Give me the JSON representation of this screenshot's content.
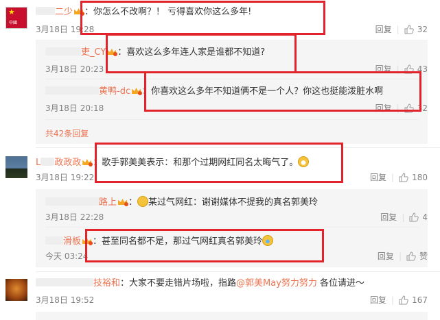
{
  "comments": [
    {
      "username_visible": "二少",
      "text": "：你怎么不改啊？！ 亏得喜欢你这么多年!",
      "time": "3月18日 19:28",
      "reply_label": "回复",
      "likes": "32",
      "replies": [
        {
          "username_visible": "吏_CY",
          "text": "：喜欢这么多年连人家是谁都不知道?",
          "time": "3月18日 20:23",
          "reply_label": "回复",
          "likes": "43"
        },
        {
          "username_visible": "黄鸭-dc",
          "text": "：你喜欢这么多年不知道俩不是一个人？你这也挺能泼脏水啊",
          "time": "3月18日 20:18",
          "reply_label": "回复",
          "likes": "32"
        }
      ],
      "more_replies": "共42条回复"
    },
    {
      "username_visible": "L",
      "username_visible_2": "政政政",
      "text": "：歌手郭美美表示：和那个过期网红同名太晦气了。",
      "time": "3月18日 19:22",
      "reply_label": "回复",
      "likes": "180",
      "replies": [
        {
          "username_visible": "路上",
          "text": "：",
          "text2": "某过气网红：谢谢媒体不提我的真名郭美玲",
          "time": "3月18日 22:28",
          "reply_label": "回复",
          "likes": "4"
        },
        {
          "username_visible": "滑板",
          "text": "：甚至同名都不是，那过气网红真名郭美玲",
          "time": "今天 03:24",
          "reply_label": "回复",
          "likes": "赞"
        }
      ]
    },
    {
      "username_visible": "技裕和",
      "text": "：大家不要走错片场啦，指路",
      "mention": "@郭美May努力努力",
      "text_after": " 各位请进～",
      "time": "3月18日 19:52",
      "reply_label": "回复",
      "likes": "167"
    }
  ],
  "avatar_flag_text": "中國",
  "colors": {
    "username": "#eb7350",
    "highlight_box": "#e3232c",
    "meta": "#808080"
  },
  "icons": [
    "vip-crown-icon",
    "thumbs-up-icon",
    "laugh-emoji",
    "grin-emoji",
    "lol-emoji"
  ]
}
